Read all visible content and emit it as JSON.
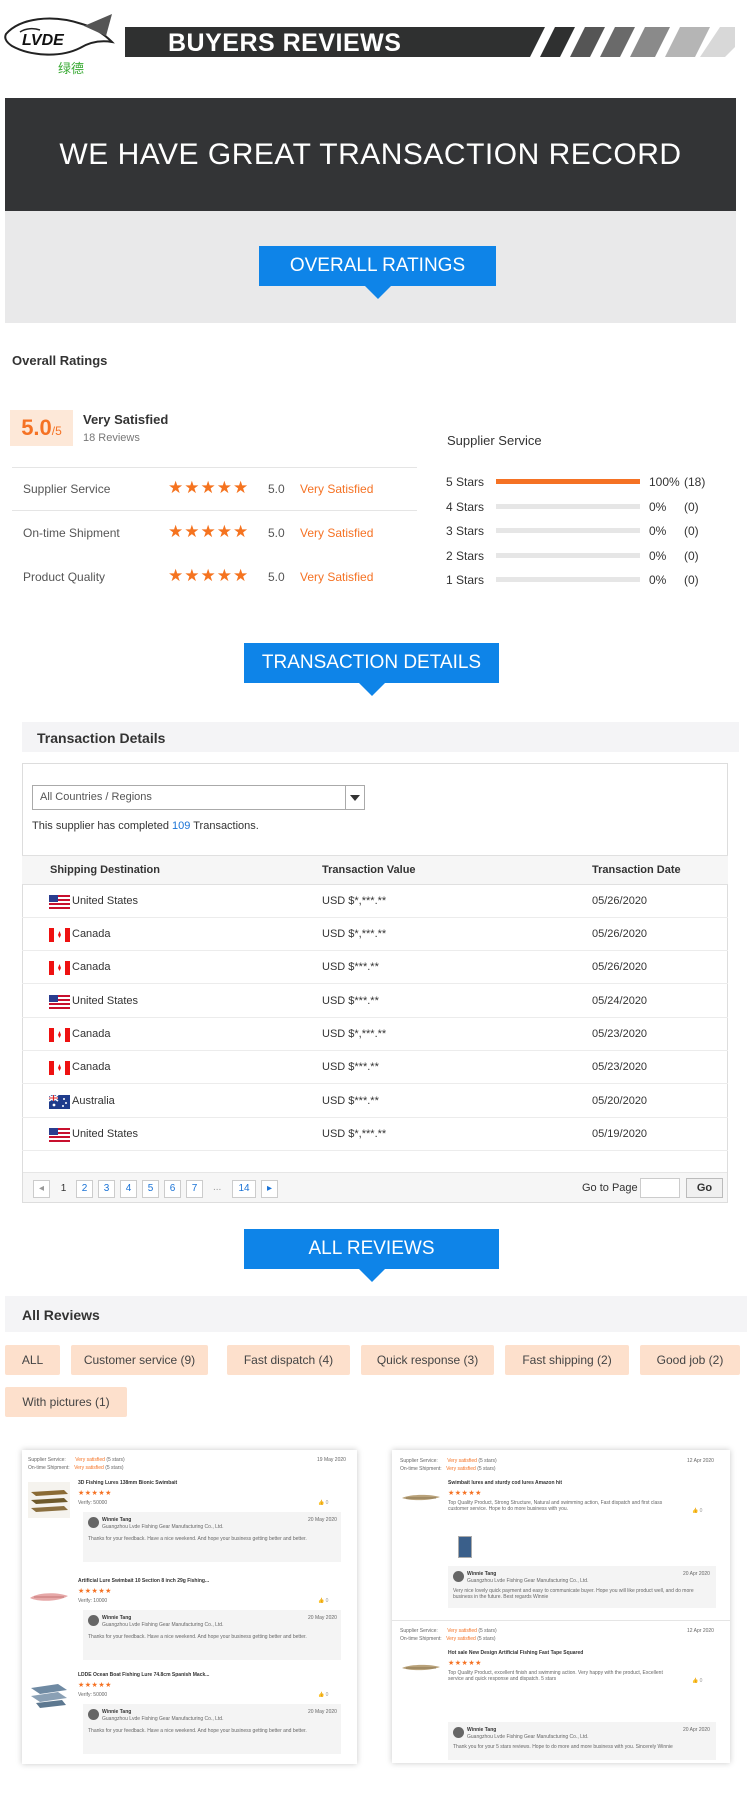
{
  "header": {
    "logo_text": "LVDE",
    "logo_cn": "绿德",
    "title": "BUYERS REVIEWS"
  },
  "hero": {
    "title": "WE HAVE GREAT TRANSACTION RECORD",
    "overall_tag": "OVERALL RATINGS"
  },
  "ratings": {
    "section_label": "Overall Ratings",
    "score": "5.0",
    "score_max": "/5",
    "summary": "Very Satisfied",
    "review_count": "18 Reviews",
    "rows": [
      {
        "label": "Supplier Service",
        "stars": "★★★★★",
        "value": "5.0",
        "text": "Very Satisfied"
      },
      {
        "label": "On-time Shipment",
        "stars": "★★★★★",
        "value": "5.0",
        "text": "Very Satisfied"
      },
      {
        "label": "Product Quality",
        "stars": "★★★★★",
        "value": "5.0",
        "text": "Very Satisfied"
      }
    ],
    "breakdown_title": "Supplier Service",
    "breakdown": [
      {
        "label": "5 Stars",
        "fraction": 1.0,
        "pct": "100%",
        "count": "(18)"
      },
      {
        "label": "4 Stars",
        "fraction": 0,
        "pct": "0%",
        "count": "(0)"
      },
      {
        "label": "3 Stars",
        "fraction": 0,
        "pct": "0%",
        "count": "(0)"
      },
      {
        "label": "2 Stars",
        "fraction": 0,
        "pct": "0%",
        "count": "(0)"
      },
      {
        "label": "1 Stars",
        "fraction": 0,
        "pct": "0%",
        "count": "(0)"
      }
    ]
  },
  "transactions": {
    "tag": "TRANSACTION DETAILS",
    "section_label": "Transaction Details",
    "select_value": "All Countries / Regions",
    "completed_prefix": "This supplier has completed ",
    "completed_count": "109",
    "completed_suffix": " Transactions.",
    "columns": [
      "Shipping Destination",
      "Transaction Value",
      "Transaction Date"
    ],
    "rows": [
      {
        "flag": "us",
        "country": "United States",
        "value": "USD $*,***.**",
        "date": "05/26/2020"
      },
      {
        "flag": "ca",
        "country": "Canada",
        "value": "USD $*,***.**",
        "date": "05/26/2020"
      },
      {
        "flag": "ca",
        "country": "Canada",
        "value": "USD $***.**",
        "date": "05/26/2020"
      },
      {
        "flag": "us",
        "country": "United States",
        "value": "USD $***.**",
        "date": "05/24/2020"
      },
      {
        "flag": "ca",
        "country": "Canada",
        "value": "USD $*,***.**",
        "date": "05/23/2020"
      },
      {
        "flag": "ca",
        "country": "Canada",
        "value": "USD $***.**",
        "date": "05/23/2020"
      },
      {
        "flag": "au",
        "country": "Australia",
        "value": "USD $***.**",
        "date": "05/20/2020"
      },
      {
        "flag": "us",
        "country": "United States",
        "value": "USD $*,***.**",
        "date": "05/19/2020"
      }
    ],
    "pager": {
      "prev": "◂",
      "next": "▸",
      "pages": [
        "1",
        "2",
        "3",
        "4",
        "5",
        "6",
        "7"
      ],
      "ellipsis": "...",
      "last": "14",
      "goto_label": "Go to Page",
      "go_button": "Go"
    }
  },
  "reviews": {
    "tag": "ALL REVIEWS",
    "section_label": "All Reviews",
    "filters": [
      "ALL",
      "Customer service (9)",
      "Fast dispatch (4)",
      "Quick response (3)",
      "Fast shipping (2)",
      "Good job (2)",
      "With pictures (1)"
    ],
    "left_card": {
      "date": "19 May 2020",
      "svc_label": "Supplier Service:",
      "svc_value": "Very satisfied",
      "svc_stars": "(5 stars)",
      "ship_label": "On-time Shipment:",
      "ship_value": "Very satisfied",
      "ship_stars": "(5 stars)",
      "items": [
        {
          "title": "3D Fishing Lures 138mm Bionic Swimbait",
          "qty": "Verify: 50000",
          "replier": "Winnie Tang",
          "company": "Guangzhou Lvde Fishing Gear Manufacturing Co., Ltd.",
          "reply_date": "20 May 2020",
          "reply": "Thanks for your feedback. Have a nice weekend. And hope your business getting better and better."
        },
        {
          "title": "Artificial Lure Swimbait 10 Section 8 inch 29g Fishing...",
          "qty": "Verify: 10000",
          "replier": "Winnie Tang",
          "company": "Guangzhou Lvde Fishing Gear Manufacturing Co., Ltd.",
          "reply_date": "20 May 2020",
          "reply": "Thanks for your feedback. Have a nice weekend. And hope your business getting better and better."
        },
        {
          "title": "LDDE Ocean Boat Fishing Lure 74.8cm Spanish Mack...",
          "qty": "Verify: 50000",
          "replier": "Winnie Tang",
          "company": "Guangzhou Lvde Fishing Gear Manufacturing Co., Ltd.",
          "reply_date": "20 May 2020",
          "reply": "Thanks for your feedback. Have a nice weekend. And hope your business getting better and better."
        }
      ]
    },
    "right_card": {
      "reviews": [
        {
          "date": "12 Apr 2020",
          "svc_label": "Supplier Service:",
          "svc_value": "Very satisfied",
          "svc_stars": "(5 stars)",
          "ship_label": "On-time Shipment:",
          "ship_value": "Very satisfied",
          "ship_stars": "(5 stars)",
          "title": "Swimbait lures and sturdy cod lures Amazon hit",
          "text": "Top Quality Product, Strong Structure, Natural and swimming action, Fast dispatch and first class customer service. Hope to do more business with you.",
          "replier": "Winnie Tang",
          "company": "Guangzhou Lvde Fishing Gear Manufacturing Co., Ltd.",
          "reply_date": "20 Apr 2020",
          "reply": "Very nice lovely quick payment and easy to communicate buyer. Hope you will like product well, and do more business in the future. Best regards Winnie"
        },
        {
          "date": "12 Apr 2020",
          "svc_label": "Supplier Service:",
          "svc_value": "Very satisfied",
          "svc_stars": "(5 stars)",
          "ship_label": "On-time Shipment:",
          "ship_value": "Very satisfied",
          "ship_stars": "(5 stars)",
          "title": "Hot sale New Design Artificial Fishing Fast Tape Squared",
          "text": "Top Quality Product, excellent finish and swimming action. Very happy with the product, Excellent service and quick response and dispatch. 5 stars",
          "replier": "Winnie Tang",
          "company": "Guangzhou Lvde Fishing Gear Manufacturing Co., Ltd.",
          "reply_date": "20 Apr 2020",
          "reply": "Thank you for your 5 stars reviews. Hope to do more and more business with you. Sincerely Winnie"
        }
      ]
    }
  },
  "colors": {
    "accent": "#f57224",
    "blue": "#0e84e8",
    "dark": "#333436"
  }
}
